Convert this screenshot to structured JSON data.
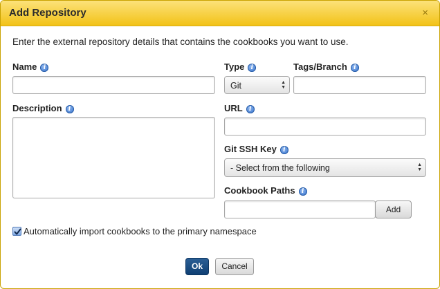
{
  "dialog": {
    "title": "Add Repository",
    "close_glyph": "×",
    "intro": "Enter the external repository details that contains the cookbooks you want to use."
  },
  "form": {
    "name_label": "Name",
    "description_label": "Description",
    "type_label": "Type",
    "type_value": "Git",
    "tags_label": "Tags/Branch",
    "url_label": "URL",
    "ssh_label": "Git SSH Key",
    "ssh_value": "- Select from the following",
    "paths_label": "Cookbook Paths",
    "add_label": "Add",
    "auto_import_label": "Automatically import cookbooks to the primary namespace",
    "auto_import_checked": true
  },
  "footer": {
    "ok_label": "Ok",
    "cancel_label": "Cancel"
  },
  "icons": {
    "info": "info-icon",
    "close": "close-icon",
    "checkmark": "checkmark-icon"
  },
  "colors": {
    "titlebar": "#f2c217",
    "primary_button": "#0f3f73",
    "info_icon": "#2f6dc9"
  }
}
